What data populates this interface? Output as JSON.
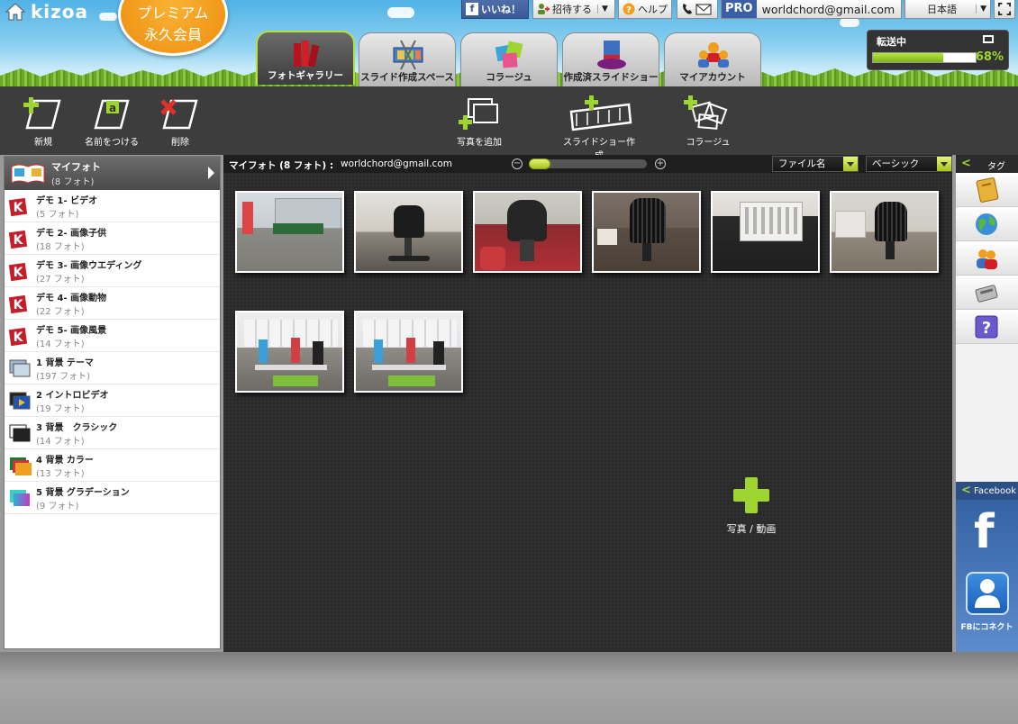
{
  "header": {
    "logo_text": "kizoa",
    "premium_line1": "プレミアム",
    "premium_line2": "永久会員",
    "fb_like_label": "いいね！",
    "invite_label": "招待する",
    "help_label": "ヘルプ",
    "pro_badge": "PRO",
    "account_email": "worldchord@gmail.com",
    "language": "日本語"
  },
  "transfer": {
    "label": "転送中",
    "percent_text": "68%",
    "progress": 0.68
  },
  "tabs": [
    {
      "label": "フォトギャラリー",
      "icon": "books-icon",
      "active": true
    },
    {
      "label": "スライド作成スペース",
      "icon": "film-scissors-icon",
      "active": false
    },
    {
      "label": "コラージュ",
      "icon": "collage-icon",
      "active": false
    },
    {
      "label": "作成済スライドショー",
      "icon": "magic-hat-icon",
      "active": false
    },
    {
      "label": "マイアカウント",
      "icon": "users-icon",
      "active": false
    }
  ],
  "toolbar": {
    "new_label": "新規",
    "rename_label": "名前をつける",
    "delete_label": "削除",
    "add_photos_label": "写真を追加",
    "create_slideshow_label": "スライドショー作成",
    "collage_label": "コラージュ"
  },
  "albums": {
    "header_title": "マイフォト",
    "header_count": "(8 フォト)",
    "items": [
      {
        "title": "デモ 1- ビデオ",
        "count": "(5 フォト)",
        "icon": "kizoa-k-icon"
      },
      {
        "title": "デモ 2- 画像子供",
        "count": "(18 フォト)",
        "icon": "kizoa-k-icon"
      },
      {
        "title": "デモ 3- 画像ウエディング",
        "count": "(27 フォト)",
        "icon": "kizoa-k-icon"
      },
      {
        "title": "デモ 4- 画像動物",
        "count": "(22 フォト)",
        "icon": "kizoa-k-icon"
      },
      {
        "title": "デモ 5- 画像風景",
        "count": "(14 フォト)",
        "icon": "kizoa-k-icon"
      },
      {
        "title": "1 背景 テーマ",
        "count": "(197 フォト)",
        "icon": "theme-stack-icon"
      },
      {
        "title": "2 イントロビデオ",
        "count": "(19 フォト)",
        "icon": "video-stack-icon"
      },
      {
        "title": "3 背景　クラシック",
        "count": "(14 フォト)",
        "icon": "classic-stack-icon"
      },
      {
        "title": "4 背景 カラー",
        "count": "(13 フォト)",
        "icon": "color-stack-icon"
      },
      {
        "title": "5 背景 グラデーション",
        "count": "(9 フォト)",
        "icon": "gradient-stack-icon"
      }
    ]
  },
  "gallery": {
    "title": "マイフォト (8 フォト) :",
    "email": "worldchord@gmail.com",
    "sort_option": "ファイル名",
    "view_option": "ベーシック",
    "add_media_label": "写真 / 動画",
    "zoom_level": 0
  },
  "rightpanel": {
    "tag_label": "タグ",
    "facebook_label": "Facebook",
    "fb_letter": "f",
    "fb_connect_label": "FBにコネクト",
    "buttons": [
      "album-icon",
      "globe-icon",
      "contacts-icon",
      "card-icon",
      "help-question-icon"
    ]
  },
  "colors": {
    "accent_green": "#9fd530",
    "premium_orange": "#f29f1d",
    "facebook_blue": "#3b5998",
    "dark_bg": "#2b2b2b"
  }
}
